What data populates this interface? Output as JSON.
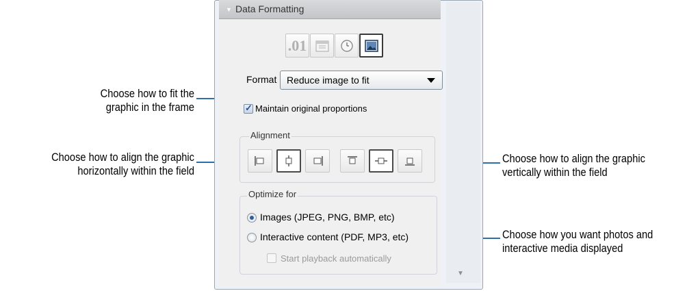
{
  "panel": {
    "header_title": "Data Formatting",
    "format_label": "Format",
    "format_value": "Reduce image to fit",
    "maintain_label": "Maintain original proportions",
    "maintain_checked": true,
    "alignment_title": "Alignment",
    "optimize_title": "Optimize for",
    "option_images": "Images (JPEG, PNG, BMP, etc)",
    "option_interactive": "Interactive content (PDF, MP3, etc)",
    "selected_option": "images",
    "playback_label": "Start playback automatically",
    "type_buttons": [
      ".01",
      "calendar-icon",
      "clock-icon",
      "image-icon"
    ],
    "selected_type": "image-icon"
  },
  "callouts": {
    "fit_line1": "Choose how to fit the",
    "fit_line2": "graphic in the frame",
    "halign_line1": "Choose how to align the graphic",
    "halign_line2": "horizontally within the field",
    "valign_line1": "Choose how to align the graphic",
    "valign_line2": "vertically within the field",
    "optimize_line1": "Choose how you want photos and",
    "optimize_line2": "interactive media displayed"
  },
  "colors": {
    "callout_line": "#2f6fa8",
    "radio_selected": "#2d5f9e"
  }
}
